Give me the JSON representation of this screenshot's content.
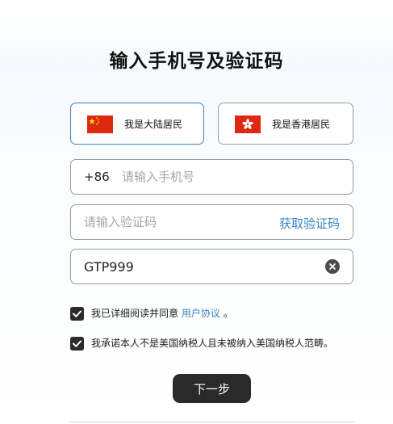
{
  "page": {
    "title": "输入手机号及验证码"
  },
  "region": {
    "options": [
      {
        "label": "我是大陆居民",
        "flag_icon": "china-flag-icon",
        "selected": true
      },
      {
        "label": "我是香港居民",
        "flag_icon": "hong-kong-flag-icon",
        "selected": false
      }
    ]
  },
  "phone": {
    "prefix": "+86",
    "placeholder": "请输入手机号",
    "value": ""
  },
  "code": {
    "placeholder": "请输入验证码",
    "value": "",
    "get_code_label": "获取验证码"
  },
  "invite": {
    "value": "GTP999",
    "clear_icon": "clear-icon"
  },
  "agreements": {
    "first_text": "我已详细阅读并同意",
    "first_link": "用户协议",
    "first_suffix": "。",
    "first_checked": true,
    "second_text": "我承诺本人不是美国纳税人且未被纳入美国纳税人范畴。",
    "second_checked": true
  },
  "actions": {
    "next_label": "下一步"
  },
  "colors": {
    "accent": "#3b82c4",
    "button_bg": "#2a2a2a",
    "checkbox_bg": "#2b2b2b",
    "placeholder": "#a6a6a6"
  }
}
